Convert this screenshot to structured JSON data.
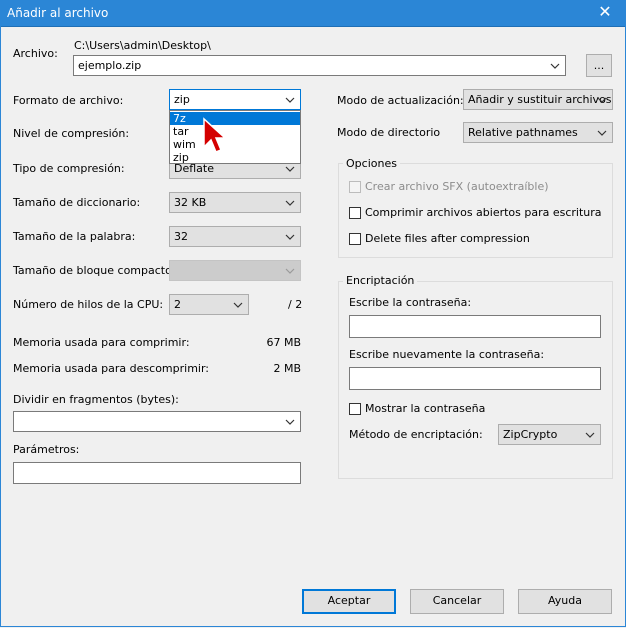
{
  "window": {
    "title": "Añadir al archivo",
    "close_symbol": "✕"
  },
  "archivo": {
    "label": "Archivo:",
    "path": "C:\\Users\\admin\\Desktop\\",
    "filename": "ejemplo.zip",
    "browse_label": "..."
  },
  "left": {
    "formato": {
      "label": "Formato de archivo:",
      "value": "zip",
      "options": [
        "7z",
        "tar",
        "wim",
        "zip"
      ],
      "highlighted": "7z"
    },
    "nivel": {
      "label": "Nivel de compresión:"
    },
    "tipo": {
      "label": "Tipo de compresión:",
      "value": "Deflate"
    },
    "diccionario": {
      "label": "Tamaño de diccionario:",
      "value": "32 KB"
    },
    "palabra": {
      "label": "Tamaño de la palabra:",
      "value": "32"
    },
    "bloque": {
      "label": "Tamaño de bloque compacto:",
      "value": ""
    },
    "hilos": {
      "label": "Número de hilos de la CPU:",
      "value": "2",
      "max": "/ 2"
    },
    "mem_comprimir": {
      "label": "Memoria usada para comprimir:",
      "value": "67 MB"
    },
    "mem_descomprimir": {
      "label": "Memoria usada para descomprimir:",
      "value": "2 MB"
    },
    "dividir": {
      "label": "Dividir en fragmentos (bytes):",
      "value": ""
    },
    "parametros": {
      "label": "Parámetros:",
      "value": ""
    }
  },
  "right": {
    "modo_actualizacion": {
      "label": "Modo de actualización:",
      "value": "Añadir y sustituir archivos"
    },
    "modo_directorio": {
      "label": "Modo de directorio",
      "value": "Relative pathnames"
    },
    "opciones": {
      "title": "Opciones",
      "sfx": "Crear archivo SFX (autoextraíble)",
      "compress_open": "Comprimir archivos abiertos para escritura",
      "delete_after": "Delete files after compression"
    },
    "encriptacion": {
      "title": "Encriptación",
      "password_label": "Escribe la contraseña:",
      "password_repeat_label": "Escribe nuevamente la contraseña:",
      "show_password": "Mostrar la contraseña",
      "method_label": "Método de encriptación:",
      "method_value": "ZipCrypto"
    }
  },
  "buttons": {
    "ok": "Aceptar",
    "cancel": "Cancelar",
    "help": "Ayuda"
  },
  "colors": {
    "titlebar": "#2b86d6",
    "selection": "#0078d7",
    "cursor": "#d40000"
  }
}
